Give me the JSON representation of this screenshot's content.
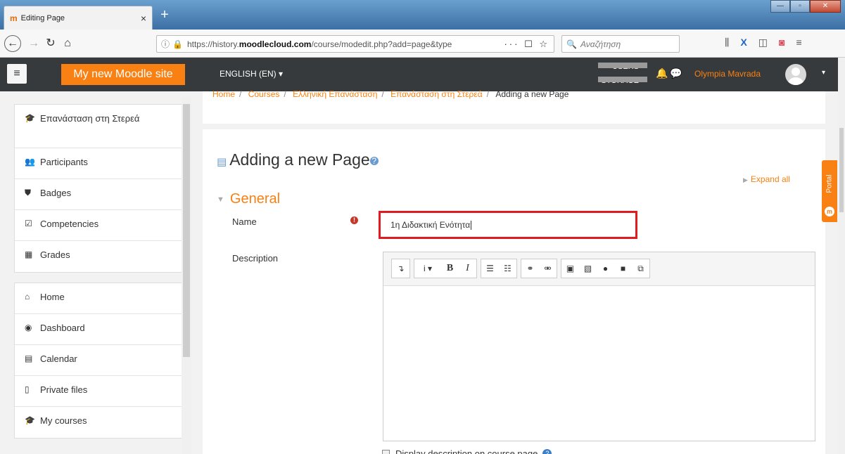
{
  "browser": {
    "tab_title": "Editing Page",
    "tab_close": "×",
    "new_tab": "+",
    "url_info_icon": "ⓘ",
    "url_prefix": "https://history.",
    "url_domain": "moodlecloud.com",
    "url_path": "/course/modedit.php?add=page&type",
    "url_actions": "··· ☐ ☆",
    "search_placeholder": "Αναζήτηση",
    "window_controls": [
      "—",
      "▫",
      "✕"
    ]
  },
  "header": {
    "menu_icon": "≡",
    "site_name": "My new Moodle site",
    "language": "ENGLISH (EN) ▾",
    "usage_labels": [
      "USERS",
      "STORAGE"
    ],
    "user_name": "Olympia Mavrada",
    "user_caret": "▾"
  },
  "breadcrumb": {
    "items": [
      "Home",
      "Courses",
      "Ελληνική Επανάσταση",
      "Επανάσταση στη Στερεά"
    ],
    "current": "Adding a new Page",
    "separator": "/"
  },
  "drawer": {
    "group1": [
      {
        "label": "Επανάσταση στη Στερεά",
        "icon": "graduation-cap-icon"
      },
      {
        "label": "Participants",
        "icon": "users-icon"
      },
      {
        "label": "Badges",
        "icon": "shield-icon"
      },
      {
        "label": "Competencies",
        "icon": "check-square-icon"
      },
      {
        "label": "Grades",
        "icon": "table-icon"
      }
    ],
    "group2": [
      {
        "label": "Home",
        "icon": "home-icon"
      },
      {
        "label": "Dashboard",
        "icon": "dashboard-icon"
      },
      {
        "label": "Calendar",
        "icon": "calendar-icon"
      },
      {
        "label": "Private files",
        "icon": "file-icon"
      },
      {
        "label": "My courses",
        "icon": "graduation-cap-icon"
      }
    ]
  },
  "form": {
    "page_title": "Adding a new Page",
    "expand_all": "Expand all",
    "section_general": "General",
    "name_label": "Name",
    "name_value": "1η Διδακτική Ενότητα",
    "description_label": "Description",
    "display_description_label": "Display description on course page"
  },
  "portal": {
    "label": "Portal"
  },
  "colors": {
    "accent": "#f98012",
    "header_bg": "#373a3c",
    "required": "#c8382a",
    "highlight_border": "#e01b22"
  }
}
